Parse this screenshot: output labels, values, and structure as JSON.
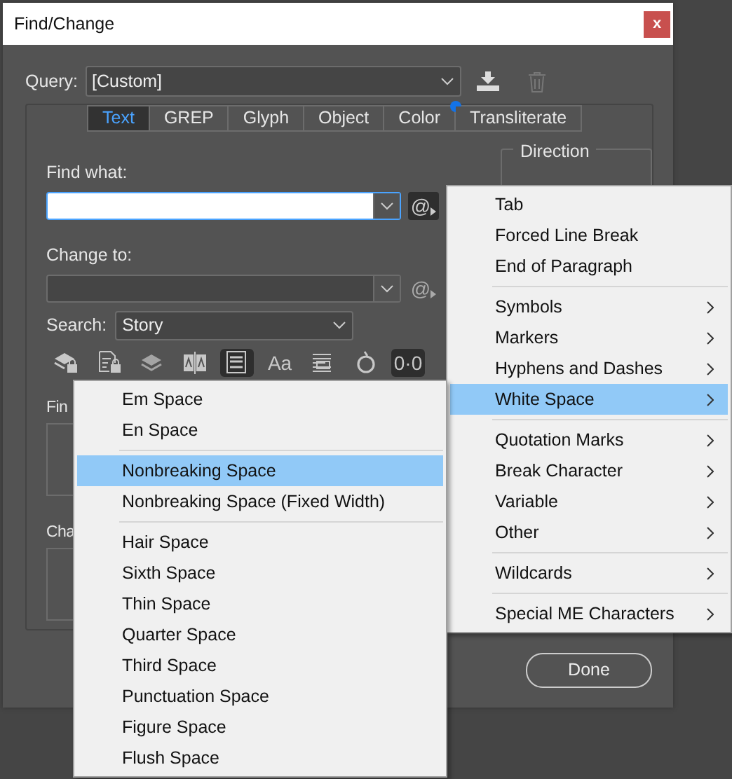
{
  "window": {
    "title": "Find/Change",
    "close": "x"
  },
  "query": {
    "label": "Query:",
    "value": "[Custom]"
  },
  "tabs": [
    {
      "label": "Text",
      "selected": true,
      "notification": false
    },
    {
      "label": "GREP",
      "selected": false,
      "notification": false
    },
    {
      "label": "Glyph",
      "selected": false,
      "notification": false
    },
    {
      "label": "Object",
      "selected": false,
      "notification": false
    },
    {
      "label": "Color",
      "selected": false,
      "notification": true
    },
    {
      "label": "Transliterate",
      "selected": false,
      "notification": false
    }
  ],
  "find_what": {
    "label": "Find what:",
    "focused": true,
    "special": "@"
  },
  "direction": {
    "label": "Direction"
  },
  "change_to": {
    "label": "Change to:",
    "focused": false,
    "special": "@"
  },
  "search": {
    "label": "Search:",
    "value": "Story"
  },
  "options": [
    {
      "kind": "lockedlayers",
      "selected": false
    },
    {
      "kind": "lockedstories",
      "selected": false
    },
    {
      "kind": "hiddenlayers",
      "selected": false
    },
    {
      "kind": "masterpages",
      "selected": false
    },
    {
      "kind": "footnotes",
      "selected": true
    },
    {
      "kind": "case",
      "selected": false,
      "label": "Aa"
    },
    {
      "kind": "wholeword",
      "selected": false
    },
    {
      "kind": "kana",
      "selected": false
    },
    {
      "kind": "width",
      "selected": true,
      "label": "0·0"
    }
  ],
  "find_format": {
    "label": "Fin"
  },
  "change_format": {
    "label": "Cha"
  },
  "done": "Done",
  "menu": {
    "groups": [
      [
        {
          "label": "Tab",
          "submenu": false,
          "selected": false
        },
        {
          "label": "Forced Line Break",
          "submenu": false,
          "selected": false
        },
        {
          "label": "End of Paragraph",
          "submenu": false,
          "selected": false
        }
      ],
      [
        {
          "label": "Symbols",
          "submenu": true,
          "selected": false
        },
        {
          "label": "Markers",
          "submenu": true,
          "selected": false
        },
        {
          "label": "Hyphens and Dashes",
          "submenu": true,
          "selected": false
        },
        {
          "label": "White Space",
          "submenu": true,
          "selected": true
        }
      ],
      [
        {
          "label": "Quotation Marks",
          "submenu": true,
          "selected": false
        },
        {
          "label": "Break Character",
          "submenu": true,
          "selected": false
        },
        {
          "label": "Variable",
          "submenu": true,
          "selected": false
        },
        {
          "label": "Other",
          "submenu": true,
          "selected": false
        }
      ],
      [
        {
          "label": "Wildcards",
          "submenu": true,
          "selected": false
        }
      ],
      [
        {
          "label": "Special ME Characters",
          "submenu": true,
          "selected": false
        }
      ]
    ]
  },
  "submenu": {
    "groups": [
      [
        {
          "label": "Em Space",
          "selected": false
        },
        {
          "label": "En Space",
          "selected": false
        }
      ],
      [
        {
          "label": "Nonbreaking Space",
          "selected": true
        },
        {
          "label": "Nonbreaking Space (Fixed Width)",
          "selected": false
        }
      ],
      [
        {
          "label": "Hair Space",
          "selected": false
        },
        {
          "label": "Sixth Space",
          "selected": false
        },
        {
          "label": "Thin Space",
          "selected": false
        },
        {
          "label": "Quarter Space",
          "selected": false
        },
        {
          "label": "Third Space",
          "selected": false
        },
        {
          "label": "Punctuation Space",
          "selected": false
        },
        {
          "label": "Figure Space",
          "selected": false
        },
        {
          "label": "Flush Space",
          "selected": false
        }
      ]
    ]
  }
}
